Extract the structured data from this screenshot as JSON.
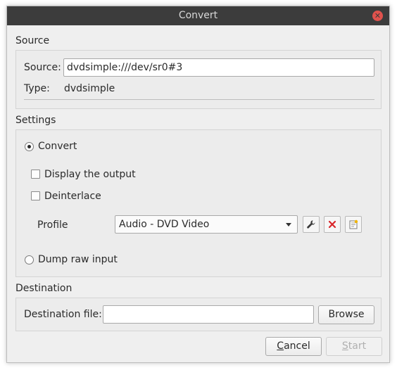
{
  "window": {
    "title": "Convert"
  },
  "source": {
    "heading": "Source",
    "source_label": "Source:",
    "source_value": "dvdsimple:///dev/sr0#3",
    "type_label": "Type:",
    "type_value": "dvdsimple"
  },
  "settings": {
    "heading": "Settings",
    "convert_label": "Convert",
    "display_output_label": "Display the output",
    "deinterlace_label": "Deinterlace",
    "profile_label": "Profile",
    "profile_value": "Audio - DVD Video",
    "dump_raw_label": "Dump raw input"
  },
  "destination": {
    "heading": "Destination",
    "file_label": "Destination file:",
    "file_value": "",
    "browse_label": "Browse"
  },
  "buttons": {
    "cancel_label": "Cancel",
    "start_label": "Start"
  },
  "colors": {
    "titlebar": "#3c3c3c",
    "close": "#e0524d",
    "delete_icon": "#d9262a"
  }
}
